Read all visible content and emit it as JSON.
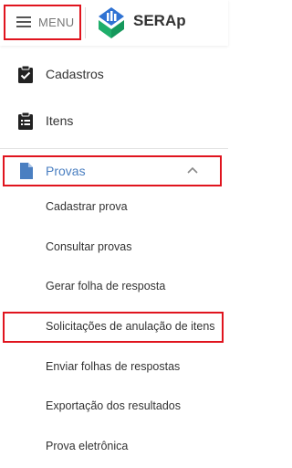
{
  "header": {
    "menu_label": "MENU",
    "app_title": "SERAp"
  },
  "sidebar": {
    "items": [
      {
        "label": "Cadastros",
        "icon": "clipboard-check-icon"
      },
      {
        "label": "Itens",
        "icon": "clipboard-list-icon"
      },
      {
        "label": "Provas",
        "icon": "document-icon",
        "expanded": true
      }
    ],
    "provas_submenu": [
      {
        "label": "Cadastrar prova"
      },
      {
        "label": "Consultar provas"
      },
      {
        "label": "Gerar folha de resposta"
      },
      {
        "label": "Solicitações de anulação de itens"
      },
      {
        "label": "Enviar folhas de respostas"
      },
      {
        "label": "Exportação dos resultados"
      },
      {
        "label": "Prova eletrônica"
      }
    ]
  },
  "colors": {
    "active": "#4a7fc1",
    "highlight": "#e0141e",
    "logo_blue": "#2f72d3",
    "logo_green": "#1fae6b"
  }
}
